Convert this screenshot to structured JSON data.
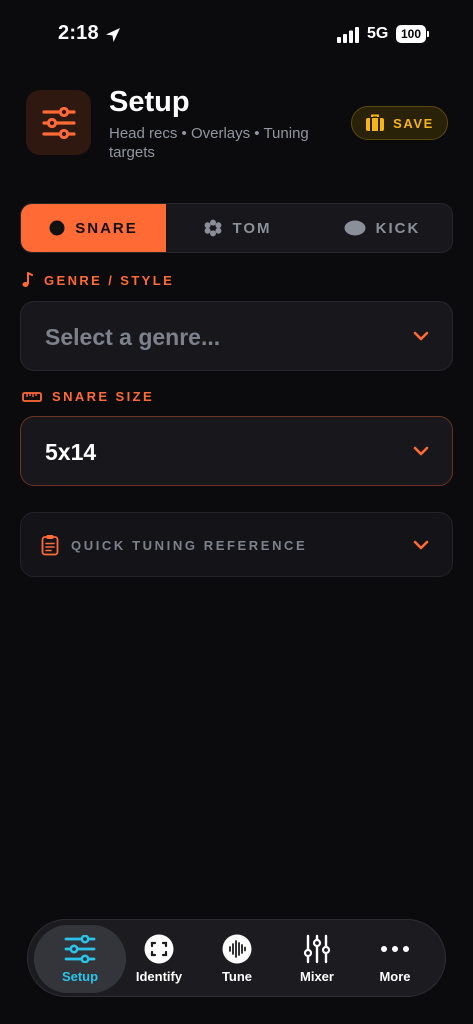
{
  "status_bar": {
    "time": "2:18",
    "network": "5G",
    "battery": "100"
  },
  "header": {
    "title": "Setup",
    "subtitle": "Head recs • Overlays • Tuning targets",
    "save_label": "SAVE"
  },
  "drum_types": {
    "items": [
      {
        "label": "SNARE",
        "icon": "filled-circle-icon",
        "active": true
      },
      {
        "label": "TOM",
        "icon": "flower-icon",
        "active": false
      },
      {
        "label": "KICK",
        "icon": "oval-icon",
        "active": false
      }
    ]
  },
  "genre": {
    "label": "GENRE / STYLE",
    "placeholder": "Select a genre..."
  },
  "snare_size": {
    "label": "SNARE SIZE",
    "value": "5x14"
  },
  "quick_ref": {
    "label": "QUICK TUNING REFERENCE"
  },
  "tab_bar": {
    "items": [
      {
        "label": "Setup",
        "icon": "sliders-icon",
        "active": true
      },
      {
        "label": "Identify",
        "icon": "scan-icon",
        "active": false
      },
      {
        "label": "Tune",
        "icon": "waveform-icon",
        "active": false
      },
      {
        "label": "Mixer",
        "icon": "mixer-icon",
        "active": false
      },
      {
        "label": "More",
        "icon": "more-icon",
        "active": false
      }
    ]
  },
  "colors": {
    "accent": "#ff6a35",
    "save": "#f5b418",
    "tab_active": "#2ac4ea",
    "background": "#0b0a0c"
  }
}
